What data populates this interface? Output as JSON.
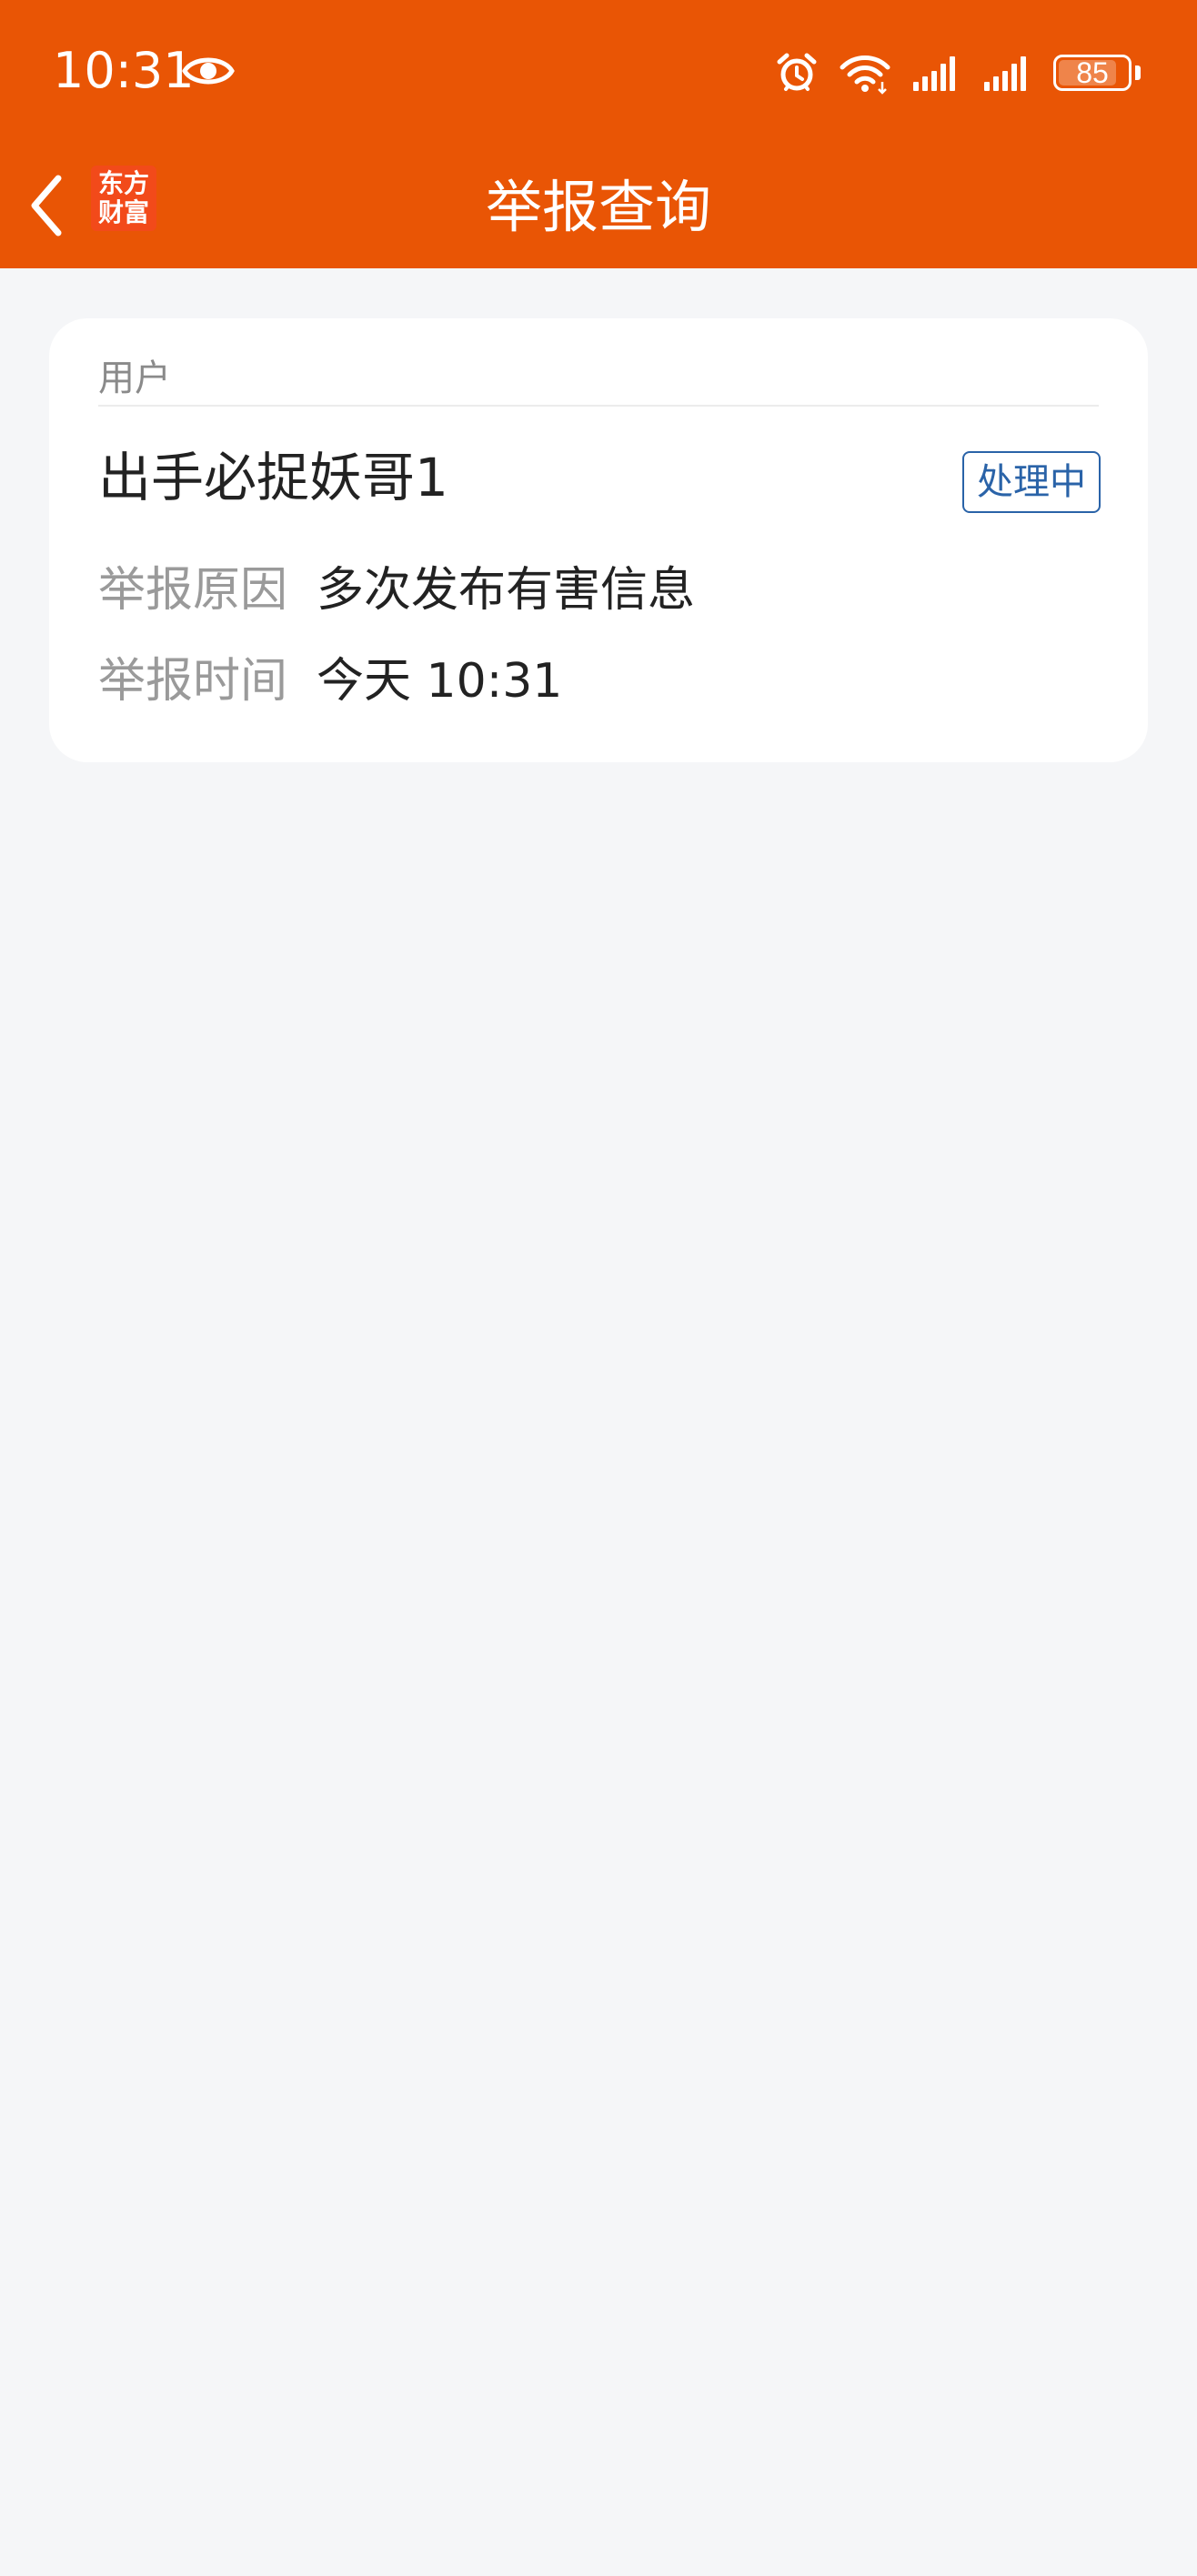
{
  "status_bar": {
    "time": "10:31",
    "battery": "85",
    "battery_level": 0.85
  },
  "nav": {
    "title": "举报查询",
    "logo_line1": "东方",
    "logo_line2": "财富"
  },
  "report": {
    "category": "用户",
    "user_name": "出手必捉妖哥1",
    "status": "处理中",
    "reason_label": "举报原因",
    "reason_value": "多次发布有害信息",
    "time_label": "举报时间",
    "time_value": "今天 10:31"
  },
  "colors": {
    "brand_orange": "#e95505",
    "status_blue": "#2a63a8",
    "background": "#f5f6f8"
  }
}
